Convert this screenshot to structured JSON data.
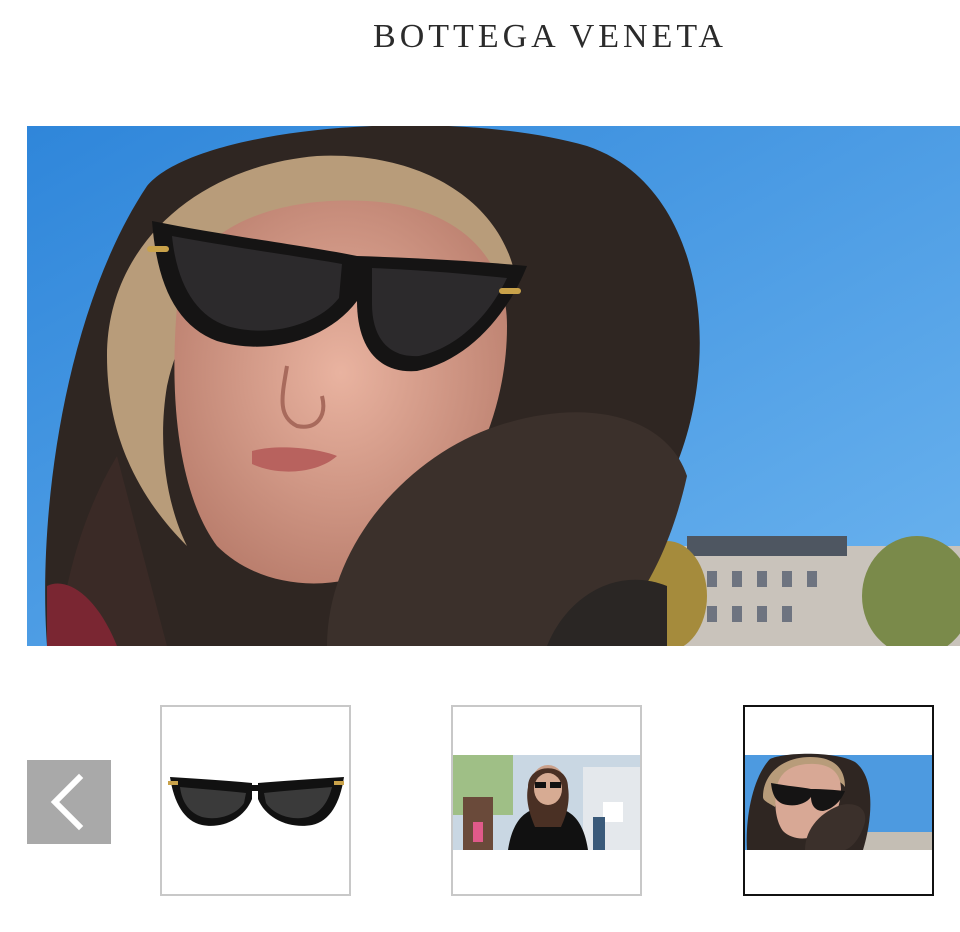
{
  "brand": {
    "name": "BOTTEGA VENETA"
  },
  "gallery": {
    "hero_image": "woman-in-fleece-hood-wearing-cat-eye-sunglasses",
    "prev_icon": "chevron-left-icon",
    "thumbnails": [
      {
        "image": "black-cat-eye-sunglasses-product",
        "selected": false
      },
      {
        "image": "woman-wearing-sunglasses-street",
        "selected": false
      },
      {
        "image": "woman-in-fleece-hood-wearing-cat-eye-sunglasses",
        "selected": true
      }
    ]
  },
  "colors": {
    "sky": "#3d8fdc",
    "prev_button": "#a9a9a9",
    "thumb_border": "#c8c8c8",
    "active_border": "#111111"
  }
}
